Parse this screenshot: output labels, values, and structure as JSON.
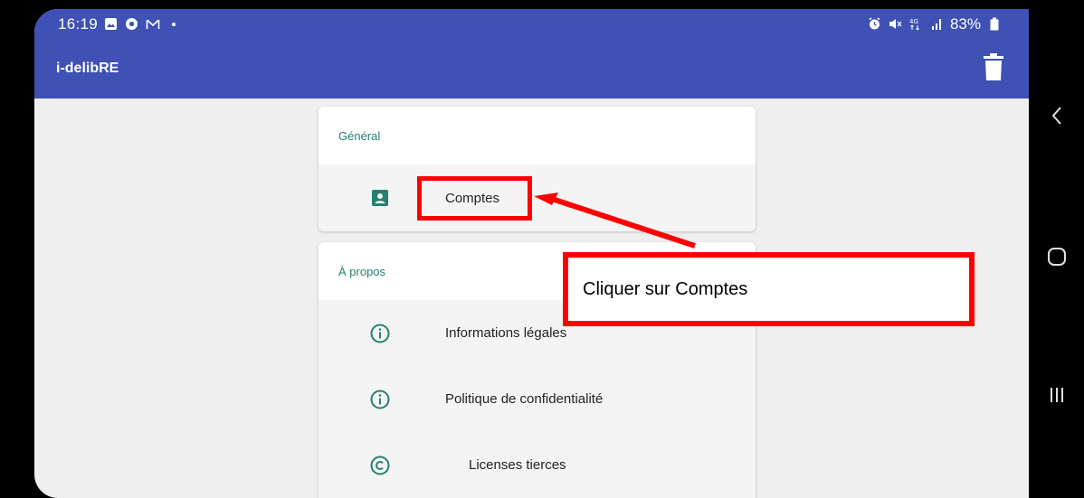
{
  "status_bar": {
    "time": "16:19",
    "left_icons": [
      "image-icon",
      "chrome-icon",
      "gmail-icon",
      "dot-icon"
    ],
    "right_icons": [
      "alarm-icon",
      "mute-icon",
      "4g-icon",
      "signal-icon"
    ],
    "battery": "83%"
  },
  "app_bar": {
    "title": "i-delibRE",
    "action_icon": "trash-icon"
  },
  "sections": {
    "general": {
      "header": "Général",
      "items": [
        {
          "label": "Comptes",
          "icon": "account-box-icon"
        }
      ]
    },
    "about": {
      "header": "À propos",
      "items": [
        {
          "label": "Informations légales",
          "icon": "info-icon"
        },
        {
          "label": "Politique de confidentialité",
          "icon": "info-icon"
        },
        {
          "label": "Licenses tierces",
          "icon": "copyright-icon"
        }
      ]
    }
  },
  "annotation": {
    "callout_text": "Cliquer sur Comptes",
    "color": "#ff0000"
  },
  "colors": {
    "app_bar": "#3f51b5",
    "accent": "#26806f",
    "background": "#efefef"
  },
  "nav_bar": {
    "buttons": [
      "back-icon",
      "home-icon",
      "recents-icon"
    ]
  }
}
